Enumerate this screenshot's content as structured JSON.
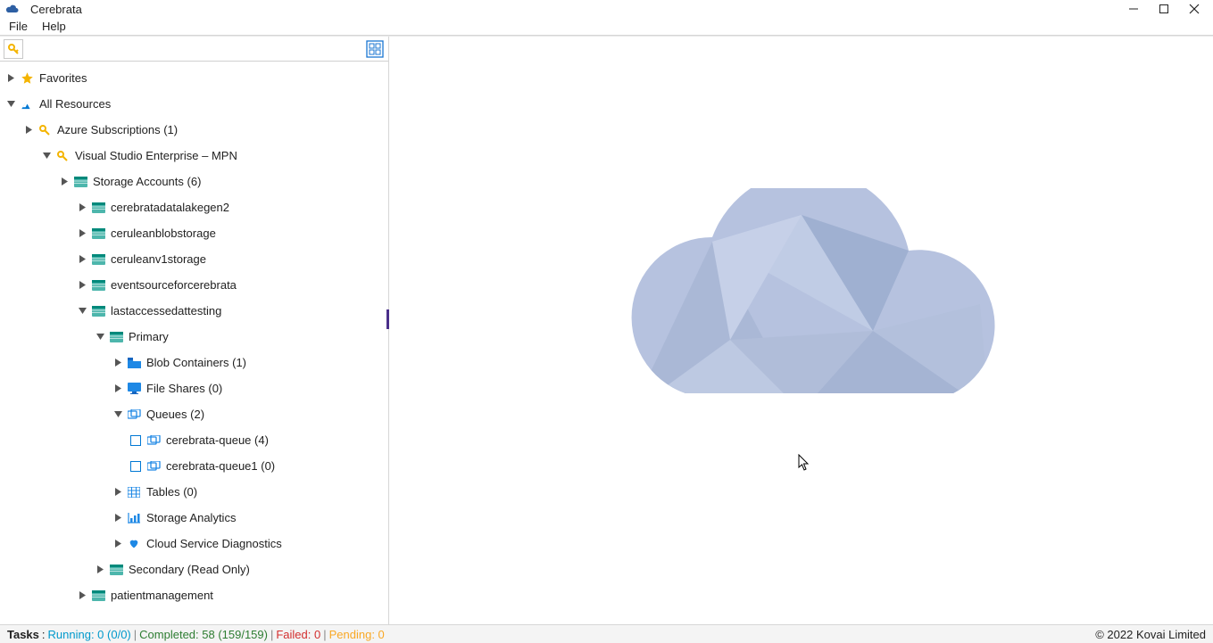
{
  "title": "Cerebrata",
  "menu": {
    "file": "File",
    "help": "Help"
  },
  "tree": {
    "favorites": "Favorites",
    "all_resources": "All Resources",
    "azure_subs": "Azure Subscriptions (1)",
    "vs_ent": "Visual Studio Enterprise – MPN",
    "storage_accounts": "Storage Accounts (6)",
    "sa": {
      "a": "cerebratadatalakegen2",
      "b": "ceruleanblobstorage",
      "c": "ceruleanv1storage",
      "d": "eventsourceforcerebrata",
      "e": "lastaccessedattesting",
      "f": "patientmanagement"
    },
    "primary": "Primary",
    "secondary": "Secondary (Read Only)",
    "blob": "Blob Containers (1)",
    "fileshares": "File Shares (0)",
    "queues": "Queues (2)",
    "q1": "cerebrata-queue (4)",
    "q2": "cerebrata-queue1 (0)",
    "tables": "Tables (0)",
    "analytics": "Storage Analytics",
    "diag": "Cloud Service Diagnostics"
  },
  "status": {
    "tasks_label": "Tasks",
    "running": "Running: 0 (0/0)",
    "completed": "Completed: 58 (159/159)",
    "failed": "Failed: 0",
    "pending": "Pending: 0",
    "copyright": "© 2022 Kovai Limited"
  }
}
